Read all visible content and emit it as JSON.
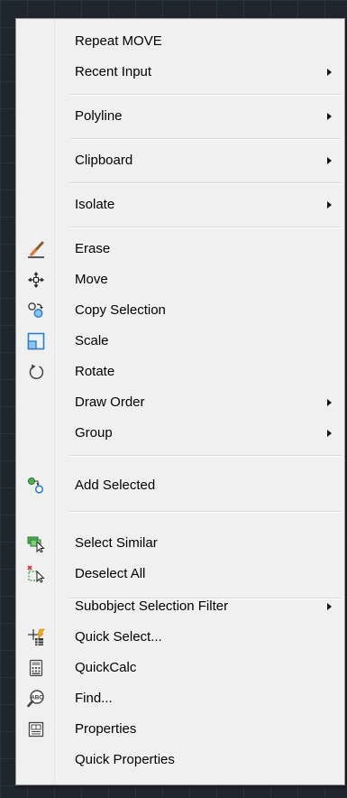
{
  "menu": {
    "items": [
      {
        "label": "Repeat MOVE"
      },
      {
        "label": "Recent Input"
      },
      {
        "label": "Polyline"
      },
      {
        "label": "Clipboard"
      },
      {
        "label": "Isolate"
      },
      {
        "label": "Erase",
        "icon": "eraser-icon"
      },
      {
        "label": "Move",
        "icon": "move-arrows-icon"
      },
      {
        "label": "Copy Selection",
        "icon": "copy-selection-icon"
      },
      {
        "label": "Scale",
        "icon": "scale-icon"
      },
      {
        "label": "Rotate",
        "icon": "rotate-icon"
      },
      {
        "label": "Draw Order"
      },
      {
        "label": "Group"
      },
      {
        "label": "Add Selected",
        "icon": "add-selected-icon"
      },
      {
        "label": "Select Similar",
        "icon": "select-similar-icon"
      },
      {
        "label": "Deselect All",
        "icon": "deselect-all-icon"
      },
      {
        "label": "Subobject Selection Filter"
      },
      {
        "label": "Quick Select...",
        "icon": "quick-select-icon"
      },
      {
        "label": "QuickCalc",
        "icon": "calculator-icon"
      },
      {
        "label": "Find...",
        "icon": "find-text-icon"
      },
      {
        "label": "Properties",
        "icon": "properties-icon"
      },
      {
        "label": "Quick Properties"
      }
    ]
  },
  "colors": {
    "menu_background": "#f0f0f0",
    "canvas_background": "#1f252d",
    "text": "#000000",
    "icon_blue": "#2e7ec9",
    "icon_green": "#3d9b3a"
  }
}
